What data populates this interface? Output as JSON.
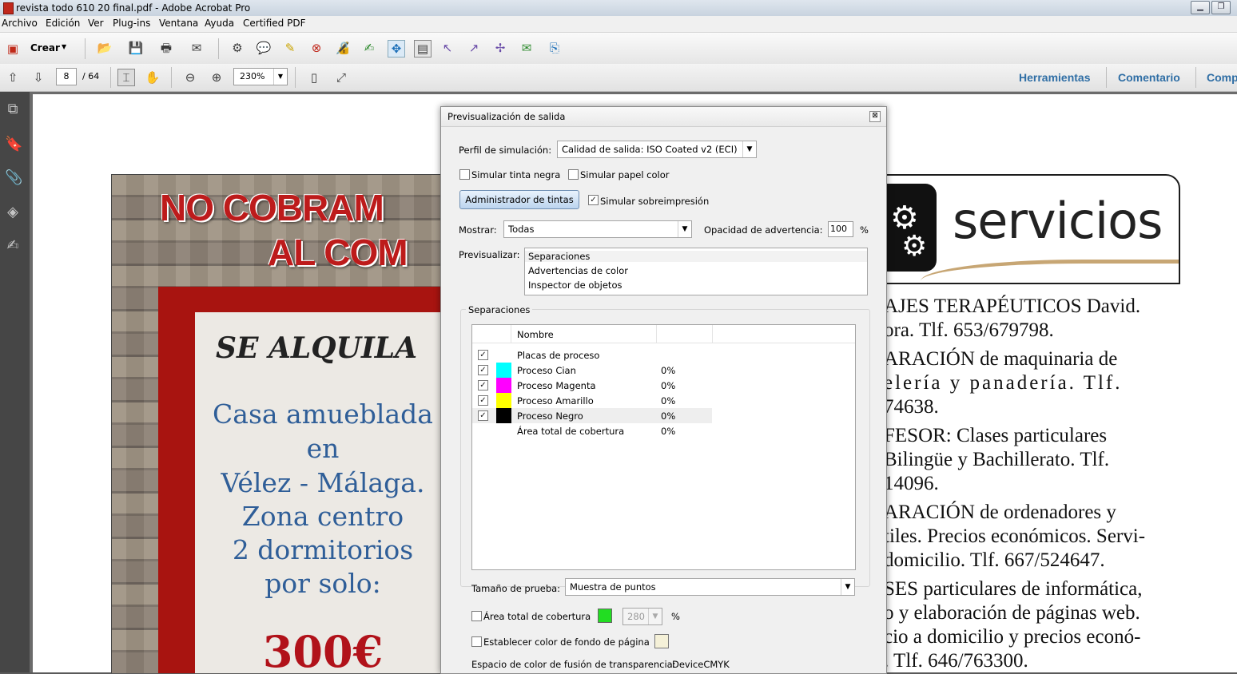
{
  "window": {
    "title": "revista todo 610 20 final.pdf - Adobe Acrobat Pro",
    "min": "▁",
    "max": "❐"
  },
  "menu": [
    "Archivo",
    "Edición",
    "Ver",
    "Plug-ins",
    "Ventana",
    "Ayuda",
    "Certified PDF"
  ],
  "toolbar": {
    "create_label": "Crear"
  },
  "nav": {
    "page_current": "8",
    "page_total": "/ 64",
    "zoom": "230%"
  },
  "panels": [
    "Herramientas",
    "Comentario",
    "Comp"
  ],
  "ad": {
    "headline1": "NO COBRAM",
    "headline2": "AL COM",
    "se_alquila": "SE ALQUILA",
    "lines": [
      "Casa amueblada",
      "en",
      "Vélez - Málaga.",
      "Zona centro",
      "2 dormitorios",
      "por solo:"
    ],
    "price": "300€"
  },
  "right_page": {
    "banner": "servicios",
    "lines": [
      "AJES TERAPÉUTICOS David.",
      "ora. Tlf. 653/679798.",
      "ARACIÓN de maquinaria de",
      "elería y panadería. Tlf.",
      "74638.",
      "FESOR: Clases particulares",
      "Bilingüe y Bachillerato. Tlf.",
      "14096.",
      "ARACIÓN de ordenadores y",
      "tiles. Precios económicos. Servi-",
      "domicilio. Tlf. 667/524647.",
      "SES particulares de informática,",
      "o y elaboración de páginas web.",
      "cio a domicilio y precios econó-",
      ". Tlf. 646/763300."
    ]
  },
  "dialog": {
    "title": "Previsualización de salida",
    "close": "⊠",
    "profile_label": "Perfil de simulación:",
    "profile_value": "Calidad de salida: ISO Coated v2 (ECI)",
    "sim_black": "Simular tinta negra",
    "sim_paper": "Simular papel color",
    "ink_manager": "Administrador de tintas",
    "sim_overprint": "Simular sobreimpresión",
    "show_label": "Mostrar:",
    "show_value": "Todas",
    "warn_label": "Opacidad de advertencia:",
    "warn_value": "100",
    "warn_unit": "%",
    "preview_label": "Previsualizar:",
    "preview_options": [
      "Separaciones",
      "Advertencias de color",
      "Inspector de objetos"
    ],
    "separations_group": "Separaciones",
    "table_header": "Nombre",
    "rows": [
      {
        "name": "Placas de proceso",
        "pct": "",
        "checked": true,
        "color": ""
      },
      {
        "name": "Proceso Cian",
        "pct": "0%",
        "checked": true,
        "color": "#00ffff"
      },
      {
        "name": "Proceso Magenta",
        "pct": "0%",
        "checked": true,
        "color": "#ff00ff"
      },
      {
        "name": "Proceso Amarillo",
        "pct": "0%",
        "checked": true,
        "color": "#ffff00"
      },
      {
        "name": "Proceso Negro",
        "pct": "0%",
        "checked": true,
        "color": "#000000"
      },
      {
        "name": "Área total de cobertura",
        "pct": "0%",
        "checked": false,
        "color": ""
      }
    ],
    "sample_label": "Tamaño de prueba:",
    "sample_value": "Muestra de puntos",
    "total_area_label": "Área total de cobertura",
    "total_area_value": "280",
    "total_area_unit": "%",
    "total_area_color": "#22dd22",
    "bg_color_label": "Establecer color de fondo de página",
    "blend_label": "Espacio de color de fusión de transparencia:",
    "blend_value": "DeviceCMYK"
  }
}
